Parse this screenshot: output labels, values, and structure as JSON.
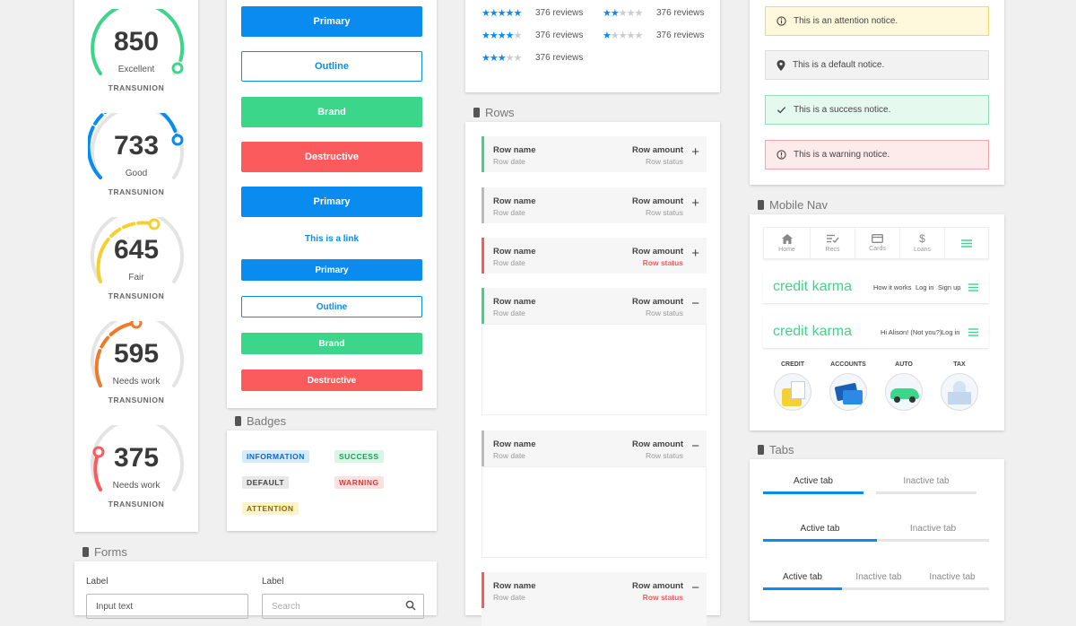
{
  "scores": [
    {
      "value": "850",
      "label": "Excellent",
      "bureau": "TRANSUNION",
      "color": "#3cd68a"
    },
    {
      "value": "733",
      "label": "Good",
      "bureau": "TRANSUNION",
      "color": "#0a8bf0"
    },
    {
      "value": "645",
      "label": "Fair",
      "bureau": "TRANSUNION",
      "color": "#f5d033"
    },
    {
      "value": "595",
      "label": "Needs work",
      "bureau": "TRANSUNION",
      "color": "#f07a28"
    },
    {
      "value": "375",
      "label": "Needs work",
      "bureau": "TRANSUNION",
      "color": "#fb5b5c"
    }
  ],
  "buttons": {
    "large": [
      "Primary",
      "Outline",
      "Brand",
      "Destructive",
      "Primary"
    ],
    "link": "This is a link",
    "small": [
      "Primary",
      "Outline",
      "Brand",
      "Destructive"
    ]
  },
  "badges": {
    "title": "Badges",
    "items": [
      "INFORMATION",
      "SUCCESS",
      "DEFAULT",
      "WARNING",
      "ATTENTION"
    ]
  },
  "forms": {
    "title": "Forms",
    "label1": "Label",
    "input1": "Input text",
    "label2": "Label",
    "search_placeholder": "Search"
  },
  "reviews": {
    "items": [
      {
        "stars": 5,
        "text": "376 reviews"
      },
      {
        "stars": 2,
        "text": "376 reviews"
      },
      {
        "stars": 4,
        "text": "376 reviews"
      },
      {
        "stars": 1,
        "text": "376 reviews"
      },
      {
        "stars": 3,
        "text": "376 reviews"
      }
    ]
  },
  "rows": {
    "title": "Rows",
    "items": [
      {
        "name": "Row name",
        "date": "Row date",
        "amount": "Row amount",
        "status": "Row status",
        "toggle": "+"
      },
      {
        "name": "Row name",
        "date": "Row date",
        "amount": "Row amount",
        "status": "Row status",
        "toggle": "+"
      },
      {
        "name": "Row name",
        "date": "Row date",
        "amount": "Row amount",
        "status": "Row status",
        "toggle": "+"
      },
      {
        "name": "Row name",
        "date": "Row date",
        "amount": "Row amount",
        "status": "Row status",
        "toggle": "−"
      },
      {
        "name": "Row name",
        "date": "Row date",
        "amount": "Row amount",
        "status": "Row status",
        "toggle": "−"
      },
      {
        "name": "Row name",
        "date": "Row date",
        "amount": "Row amount",
        "status": "Row status",
        "toggle": "−"
      }
    ]
  },
  "notices": [
    "This is an attention notice.",
    "This is a default notice.",
    "This is a success notice.",
    "This is a warning notice."
  ],
  "mobile_nav": {
    "title": "Mobile Nav",
    "tabs": [
      "Home",
      "Recs",
      "Cards",
      "Loans"
    ],
    "logo": "credit karma",
    "links1": [
      "How it works",
      "Log in",
      "Sign up"
    ],
    "greeting": "Hi Alison! (Not you?)",
    "login2": "Log in",
    "categories": [
      "CREDIT",
      "ACCOUNTS",
      "AUTO",
      "TAX"
    ]
  },
  "tabs": {
    "title": "Tabs",
    "set1": [
      "Active tab",
      "Inactive tab"
    ],
    "set2": [
      "Active tab",
      "Inactive tab"
    ],
    "set3": [
      "Active tab",
      "Inactive tab",
      "Inactive tab"
    ]
  },
  "colors": {
    "primary": "#0a8bf0",
    "brand": "#3cd68a",
    "destructive": "#fb5b5c",
    "attention": "#f5d033"
  }
}
